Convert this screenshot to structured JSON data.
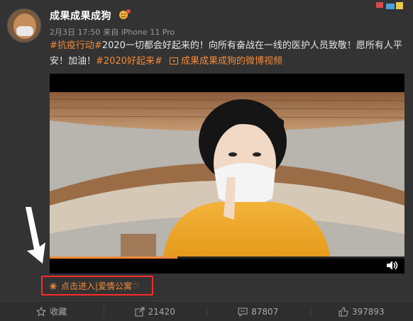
{
  "user": {
    "name": "成果成果成狗",
    "avatar_icon": "avatar-icon",
    "badge_icon": "verified-badge-icon"
  },
  "meta": {
    "date": "2月3日 17:50",
    "source": "来自 iPhone 11 Pro"
  },
  "post": {
    "hashtag1": "#抗疫行动#",
    "text1": "2020一切都会好起来的！向所有奋战在一线的医护人员致敬！愿所有人平安！加油！",
    "hashtag2": "#2020好起来#",
    "video_link": "成果成果成狗的微博视频"
  },
  "video": {
    "progress_percent": 36,
    "volume_icon": "volume-icon"
  },
  "promo": {
    "label": "点击进入|爱情公寓♡",
    "icon": "snowflake-icon"
  },
  "actions": [
    {
      "label": "收藏",
      "icon": "star-icon"
    },
    {
      "label": "21420",
      "icon": "share-icon"
    },
    {
      "label": "87807",
      "icon": "comment-icon"
    },
    {
      "label": "397893",
      "icon": "like-icon"
    }
  ],
  "colors": {
    "accent": "#f28a3a",
    "highlight_box": "#ff2a2a",
    "background": "#333333"
  }
}
